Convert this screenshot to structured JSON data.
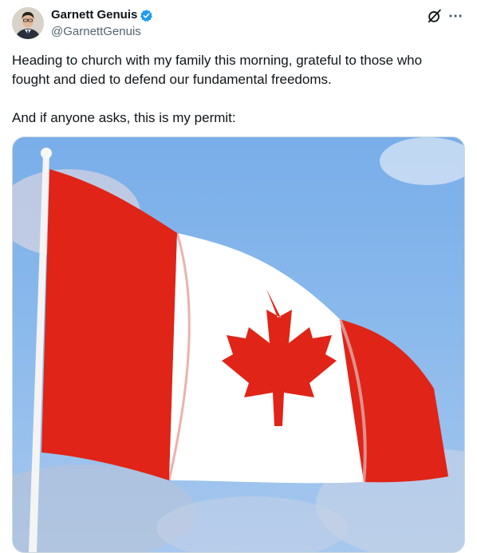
{
  "author": {
    "name": "Garnett Genuis",
    "handle": "@GarnettGenuis",
    "verified_color": "#1d9bf0"
  },
  "tweet": {
    "paragraphs": [
      "Heading to church with my family this morning, grateful to those who fought and died to defend our fundamental freedoms.",
      "And if anyone asks, this is my permit:"
    ]
  },
  "icons": {
    "verified": "verified-badge-icon",
    "grok": "grok-icon",
    "more": "more-options-icon"
  },
  "media": {
    "subject": "canadian-flag-image",
    "colors": {
      "red": "#e02417",
      "white": "#ffffff",
      "sky": "#7fb2ea"
    }
  }
}
